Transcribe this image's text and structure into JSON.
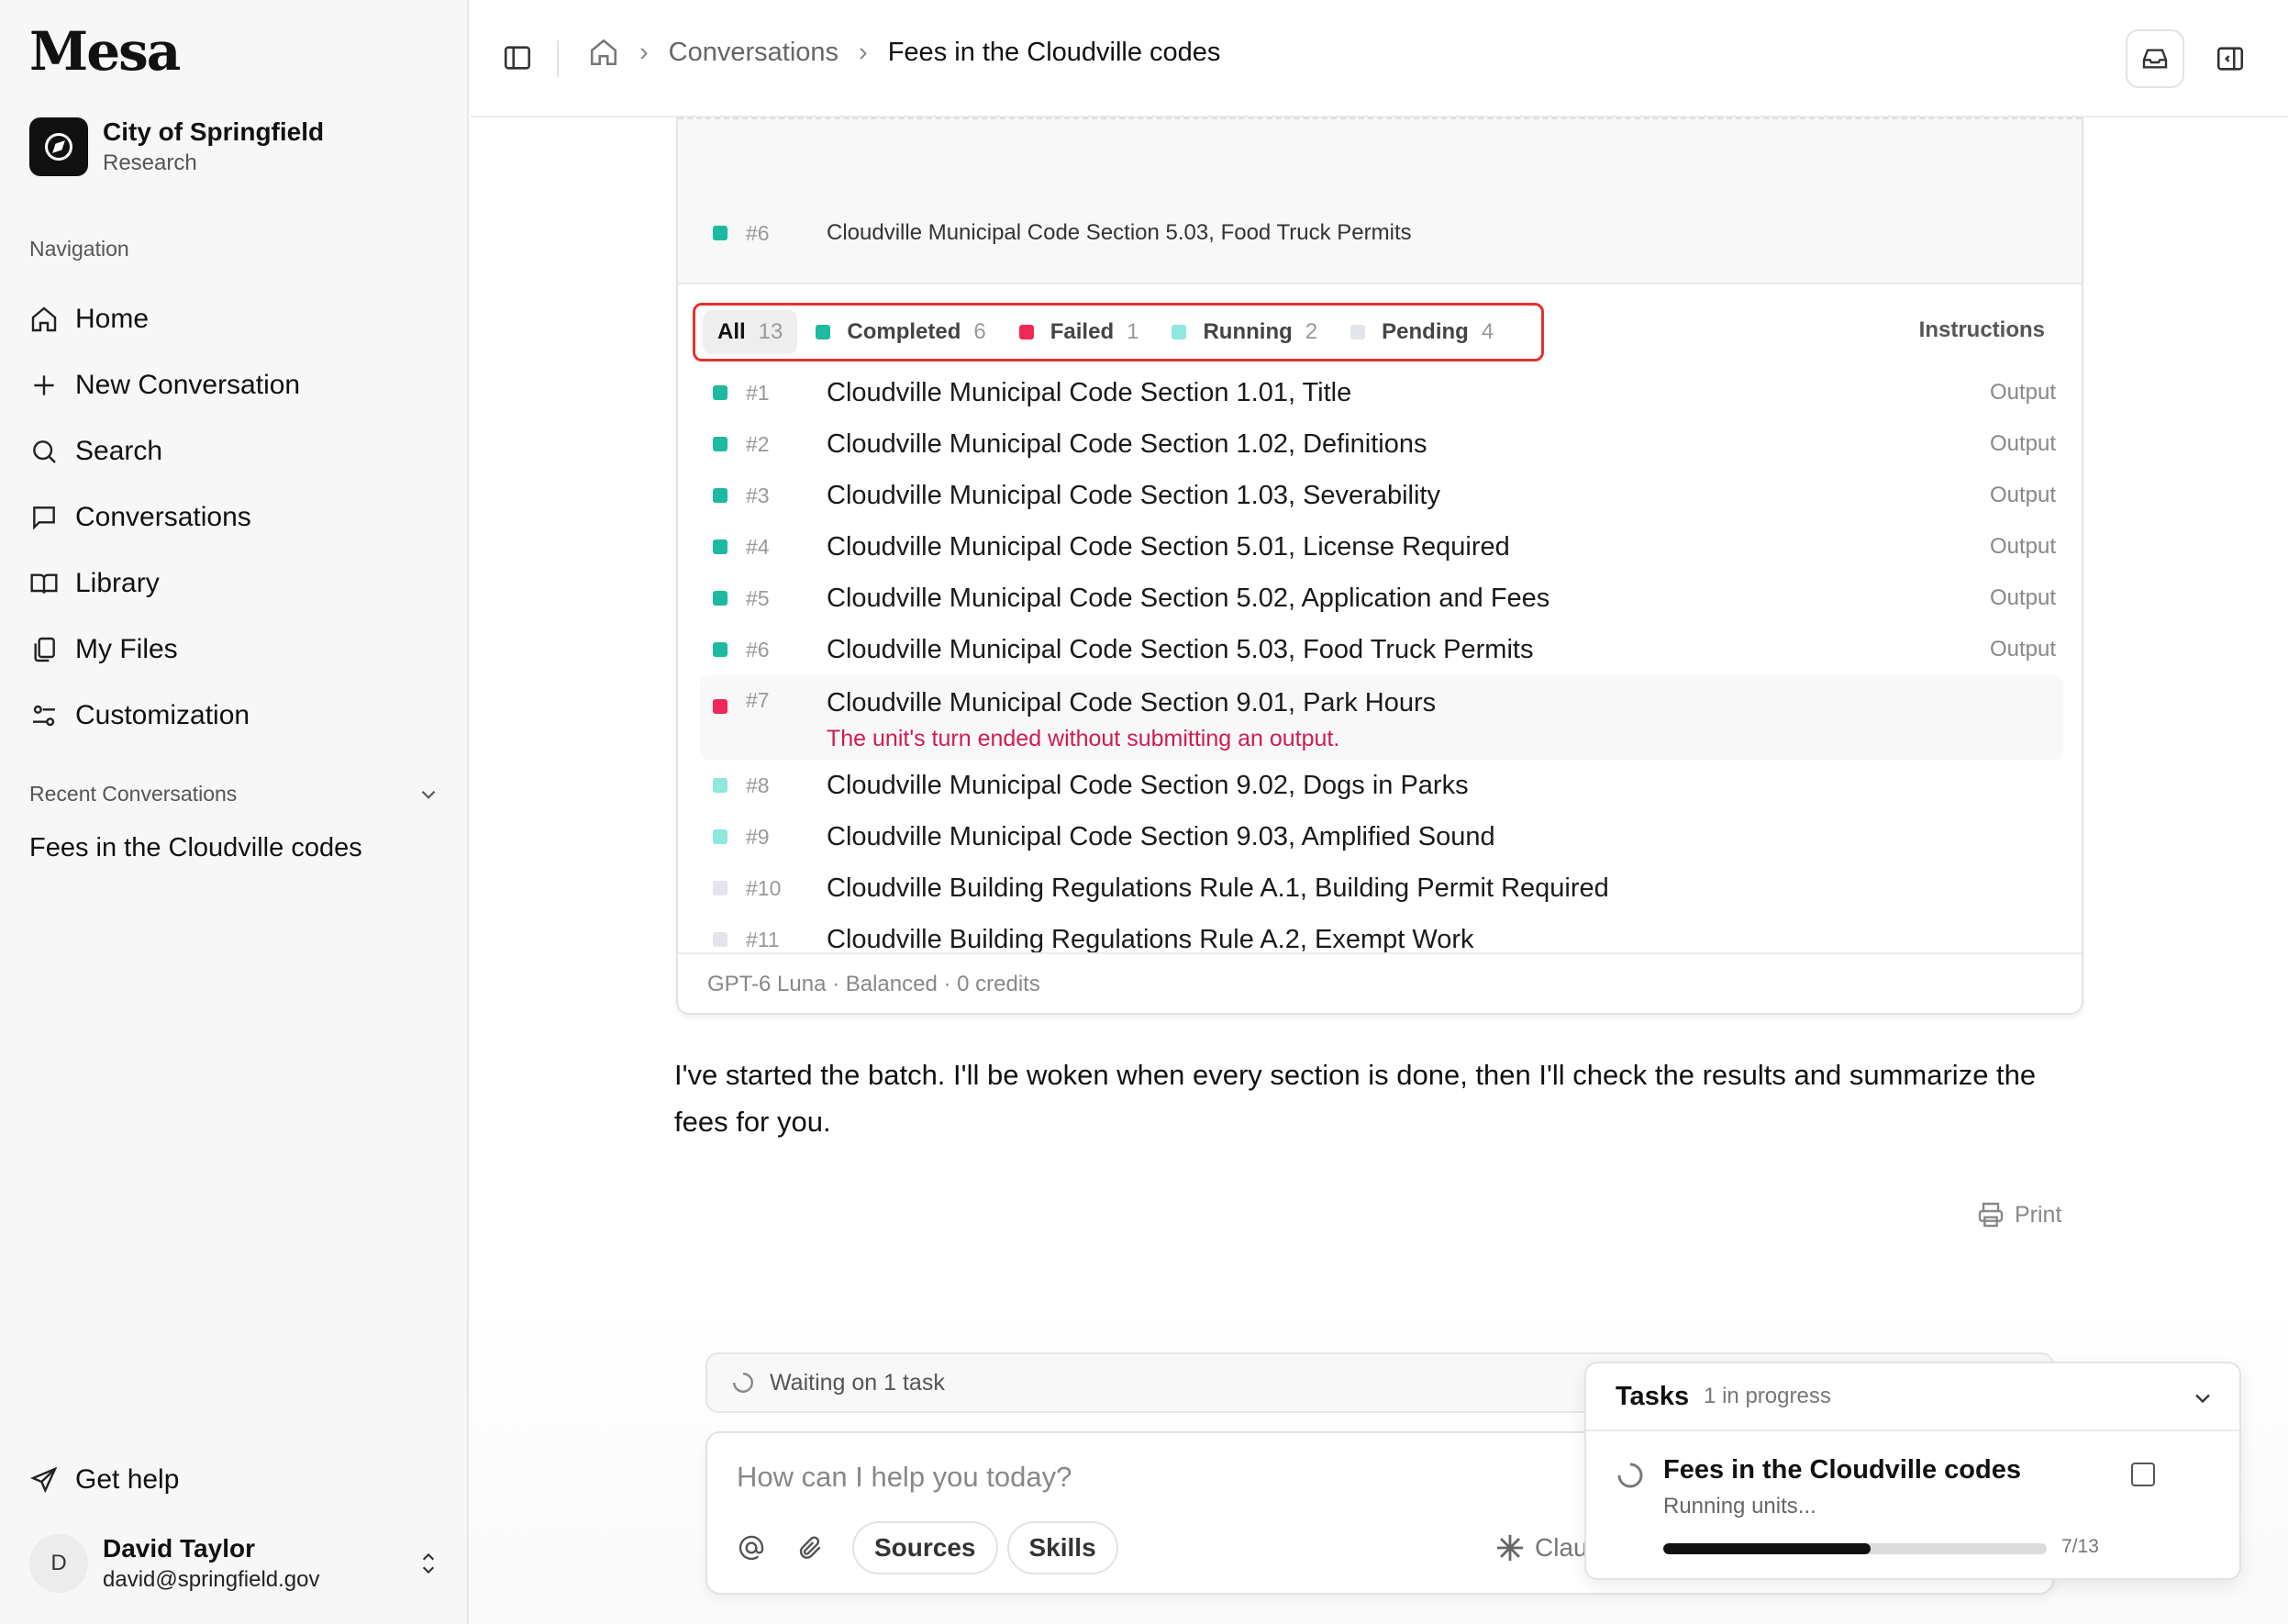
{
  "app": {
    "logo": "Mesa"
  },
  "org": {
    "name": "City of Springfield",
    "subtitle": "Research"
  },
  "nav": {
    "heading": "Navigation",
    "items": [
      {
        "label": "Home",
        "icon": "home-icon"
      },
      {
        "label": "New Conversation",
        "icon": "plus-icon"
      },
      {
        "label": "Search",
        "icon": "search-icon"
      },
      {
        "label": "Conversations",
        "icon": "chat-icon"
      },
      {
        "label": "Library",
        "icon": "book-icon"
      },
      {
        "label": "My Files",
        "icon": "files-icon"
      },
      {
        "label": "Customization",
        "icon": "sliders-icon"
      }
    ]
  },
  "recent": {
    "heading": "Recent Conversations",
    "items": [
      "Fees in the Cloudville codes"
    ]
  },
  "help": {
    "label": "Get help"
  },
  "user": {
    "initial": "D",
    "name": "David Taylor",
    "email": "david@springfield.gov"
  },
  "breadcrumb": {
    "parent": "Conversations",
    "current": "Fees in the Cloudville codes"
  },
  "batch": {
    "top_row": {
      "num": "#6",
      "title": "Cloudville Municipal Code Section 5.03, Food Truck Permits"
    },
    "filters": [
      {
        "label": "All",
        "count": "13",
        "color": ""
      },
      {
        "label": "Completed",
        "count": "6",
        "color": "#1db9a0"
      },
      {
        "label": "Failed",
        "count": "1",
        "color": "#f0285a"
      },
      {
        "label": "Running",
        "count": "2",
        "color": "#8ee8dc"
      },
      {
        "label": "Pending",
        "count": "4",
        "color": "#e2e6ea"
      }
    ],
    "instructions_label": "Instructions",
    "rows": [
      {
        "num": "#1",
        "title": "Cloudville Municipal Code Section 1.01, Title",
        "status": "completed",
        "action": "Output"
      },
      {
        "num": "#2",
        "title": "Cloudville Municipal Code Section 1.02, Definitions",
        "status": "completed",
        "action": "Output"
      },
      {
        "num": "#3",
        "title": "Cloudville Municipal Code Section 1.03, Severability",
        "status": "completed",
        "action": "Output"
      },
      {
        "num": "#4",
        "title": "Cloudville Municipal Code Section 5.01, License Required",
        "status": "completed",
        "action": "Output"
      },
      {
        "num": "#5",
        "title": "Cloudville Municipal Code Section 5.02, Application and Fees",
        "status": "completed",
        "action": "Output"
      },
      {
        "num": "#6",
        "title": "Cloudville Municipal Code Section 5.03, Food Truck Permits",
        "status": "completed",
        "action": "Output"
      },
      {
        "num": "#7",
        "title": "Cloudville Municipal Code Section 9.01, Park Hours",
        "status": "failed",
        "error": "The unit's turn ended without submitting an output."
      },
      {
        "num": "#8",
        "title": "Cloudville Municipal Code Section 9.02, Dogs in Parks",
        "status": "running"
      },
      {
        "num": "#9",
        "title": "Cloudville Municipal Code Section 9.03, Amplified Sound",
        "status": "running"
      },
      {
        "num": "#10",
        "title": "Cloudville Building Regulations Rule A.1, Building Permit Required",
        "status": "pending"
      },
      {
        "num": "#11",
        "title": "Cloudville Building Regulations Rule A.2, Exempt Work",
        "status": "pending"
      }
    ],
    "footer": "GPT-6 Luna · Balanced · 0 credits"
  },
  "message": {
    "text": "I've started the batch. I'll be woken when every section is done, then I'll check the results and summarize the fees for you."
  },
  "print_label": "Print",
  "composer": {
    "waiting": "Waiting on 1 task",
    "placeholder": "How can I help you today?",
    "sources": "Sources",
    "skills": "Skills",
    "model_partial": "Clau"
  },
  "tasks": {
    "title": "Tasks",
    "subtitle": "1 in progress",
    "item": {
      "title": "Fees in the Cloudville codes",
      "status": "Running units...",
      "progress_text": "7/13",
      "progress": 0.54
    }
  },
  "colors": {
    "completed": "#1db9a0",
    "failed": "#f0285a",
    "running": "#8ee8dc",
    "pending": "#e2e6ea",
    "error_text": "#d11a50",
    "highlight_border": "#e0332b"
  }
}
